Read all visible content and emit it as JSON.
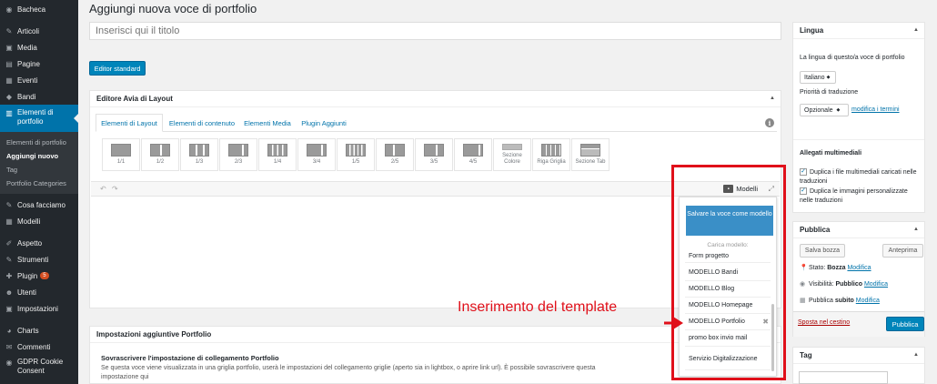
{
  "sidebar": {
    "items": [
      {
        "label": "Bacheca",
        "icon": "dashboard-icon",
        "glyph": "◉"
      },
      {
        "label": "Articoli",
        "icon": "pin-icon",
        "glyph": "✎"
      },
      {
        "label": "Media",
        "icon": "media-icon",
        "glyph": "▣"
      },
      {
        "label": "Pagine",
        "icon": "pages-icon",
        "glyph": "▤"
      },
      {
        "label": "Eventi",
        "icon": "calendar-icon",
        "glyph": "▦"
      },
      {
        "label": "Bandi",
        "icon": "diamond-icon",
        "glyph": "◆"
      },
      {
        "label": "Elementi di portfolio",
        "icon": "portfolio-icon",
        "glyph": "▥"
      },
      {
        "label": "Cosa facciamo",
        "icon": "pin-icon",
        "glyph": "✎"
      },
      {
        "label": "Modelli",
        "icon": "grid-icon",
        "glyph": "▦"
      },
      {
        "label": "Aspetto",
        "icon": "appearance-icon",
        "glyph": "✐"
      },
      {
        "label": "Strumenti",
        "icon": "tools-icon",
        "glyph": "✎"
      },
      {
        "label": "Plugin",
        "icon": "plugin-icon",
        "glyph": "✚",
        "badge": "5"
      },
      {
        "label": "Utenti",
        "icon": "users-icon",
        "glyph": "☻"
      },
      {
        "label": "Impostazioni",
        "icon": "settings-icon",
        "glyph": "▣"
      },
      {
        "label": "Charts",
        "icon": "charts-icon",
        "glyph": "◕"
      },
      {
        "label": "Commenti",
        "icon": "comments-icon",
        "glyph": "✉"
      },
      {
        "label": "GDPR Cookie Consent",
        "icon": "gdpr-icon",
        "glyph": "◉"
      }
    ],
    "submenu": [
      "Elementi di portfolio",
      "Aggiungi nuovo",
      "Tag",
      "Portfolio Categories"
    ]
  },
  "main": {
    "page_title": "Aggiungi nuova voce di portfolio",
    "title_placeholder": "Inserisci qui il titolo",
    "editor_button": "Editor standard"
  },
  "avia": {
    "title": "Editore Avia di Layout",
    "tabs": [
      "Elementi di Layout",
      "Elementi di contenuto",
      "Elementi Media",
      "Plugin Aggiunti"
    ],
    "elements": [
      "1/1",
      "1/2",
      "1/3",
      "2/3",
      "1/4",
      "3/4",
      "1/5",
      "2/5",
      "3/5",
      "4/5",
      "Sezione Colore",
      "Riga Griglia",
      "Sezione Tab"
    ],
    "models_label": "Modelli",
    "undo": "↶",
    "redo": "↷"
  },
  "dropdown": {
    "save_button": "Salvare la voce come modello",
    "load_label": "Carica modello:",
    "models": [
      "Form progetto",
      "MODELLO Bandi",
      "MODELLO Blog",
      "MODELLO Homepage",
      "MODELLO Portfolio",
      "promo box invio mail",
      "Servizio Digitalizzazione"
    ]
  },
  "annotation": {
    "text": "Inserimento del template",
    "color": "#e0101a"
  },
  "extra": {
    "title": "Impostazioni aggiuntive Portfolio",
    "subtitle": "Sovrascrivere l'impostazione di collegamento Portfolio",
    "description": "Se questa voce viene visualizzata in una griglia portfolio, userà le impostazioni del collegamento griglie (aperto sia in lightbox, o aprire link url). È possibile sovrascrivere questa impostazione qui"
  },
  "lingua": {
    "title": "Lingua",
    "lang_label": "La lingua di questo/a voce di portfolio",
    "lang_value": "Italiano",
    "priority_label": "Priorità di traduzione",
    "priority_value": "Opzionale",
    "modify_link": "modifica i termini",
    "media_title": "Allegati multimediali",
    "check1": "Duplica i file multimediali caricati nelle traduzioni",
    "check2": "Duplica le immagini personalizzate nelle traduzioni"
  },
  "publish": {
    "title": "Pubblica",
    "save_draft": "Salva bozza",
    "preview": "Anteprima",
    "status_label": "Stato:",
    "status_value": "Bozza",
    "visibility_label": "Visibilità:",
    "visibility_value": "Pubblico",
    "publish_label": "Pubblica",
    "publish_value": "subito",
    "modify": "Modifica",
    "trash": "Sposta nel cestino",
    "publish_button": "Pubblica"
  },
  "tag": {
    "title": "Tag"
  },
  "colors": {
    "sidebar_bg": "#23282d",
    "accent": "#0073aa",
    "button": "#0085ba",
    "highlight": "#e0101a"
  }
}
